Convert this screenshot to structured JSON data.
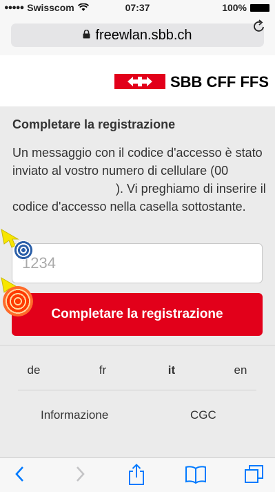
{
  "status_bar": {
    "carrier": "Swisscom",
    "time": "07:37",
    "battery": "100%"
  },
  "browser": {
    "url": "freewlan.sbb.ch"
  },
  "header": {
    "logo_text": "SBB CFF FFS"
  },
  "main": {
    "title": "Completare la registrazione",
    "message_before": "Un messaggio con il codice d'accesso è stato inviato al vostro numero di cellulare (00",
    "message_after": "). Vi preghiamo di inserire il codice d'accesso nella casella sottostante.",
    "code_placeholder": "1234",
    "submit_label": "Completare la registrazione"
  },
  "languages": [
    {
      "label": "de",
      "active": false
    },
    {
      "label": "fr",
      "active": false
    },
    {
      "label": "it",
      "active": true
    },
    {
      "label": "en",
      "active": false
    }
  ],
  "footer": {
    "info_label": "Informazione",
    "cgc_label": "CGC"
  },
  "colors": {
    "brand_red": "#e2001a",
    "ios_blue": "#007aff",
    "content_bg": "#ebebeb"
  },
  "toolbar_icons": [
    "back-icon",
    "forward-icon",
    "share-icon",
    "bookmarks-icon",
    "tabs-icon"
  ]
}
